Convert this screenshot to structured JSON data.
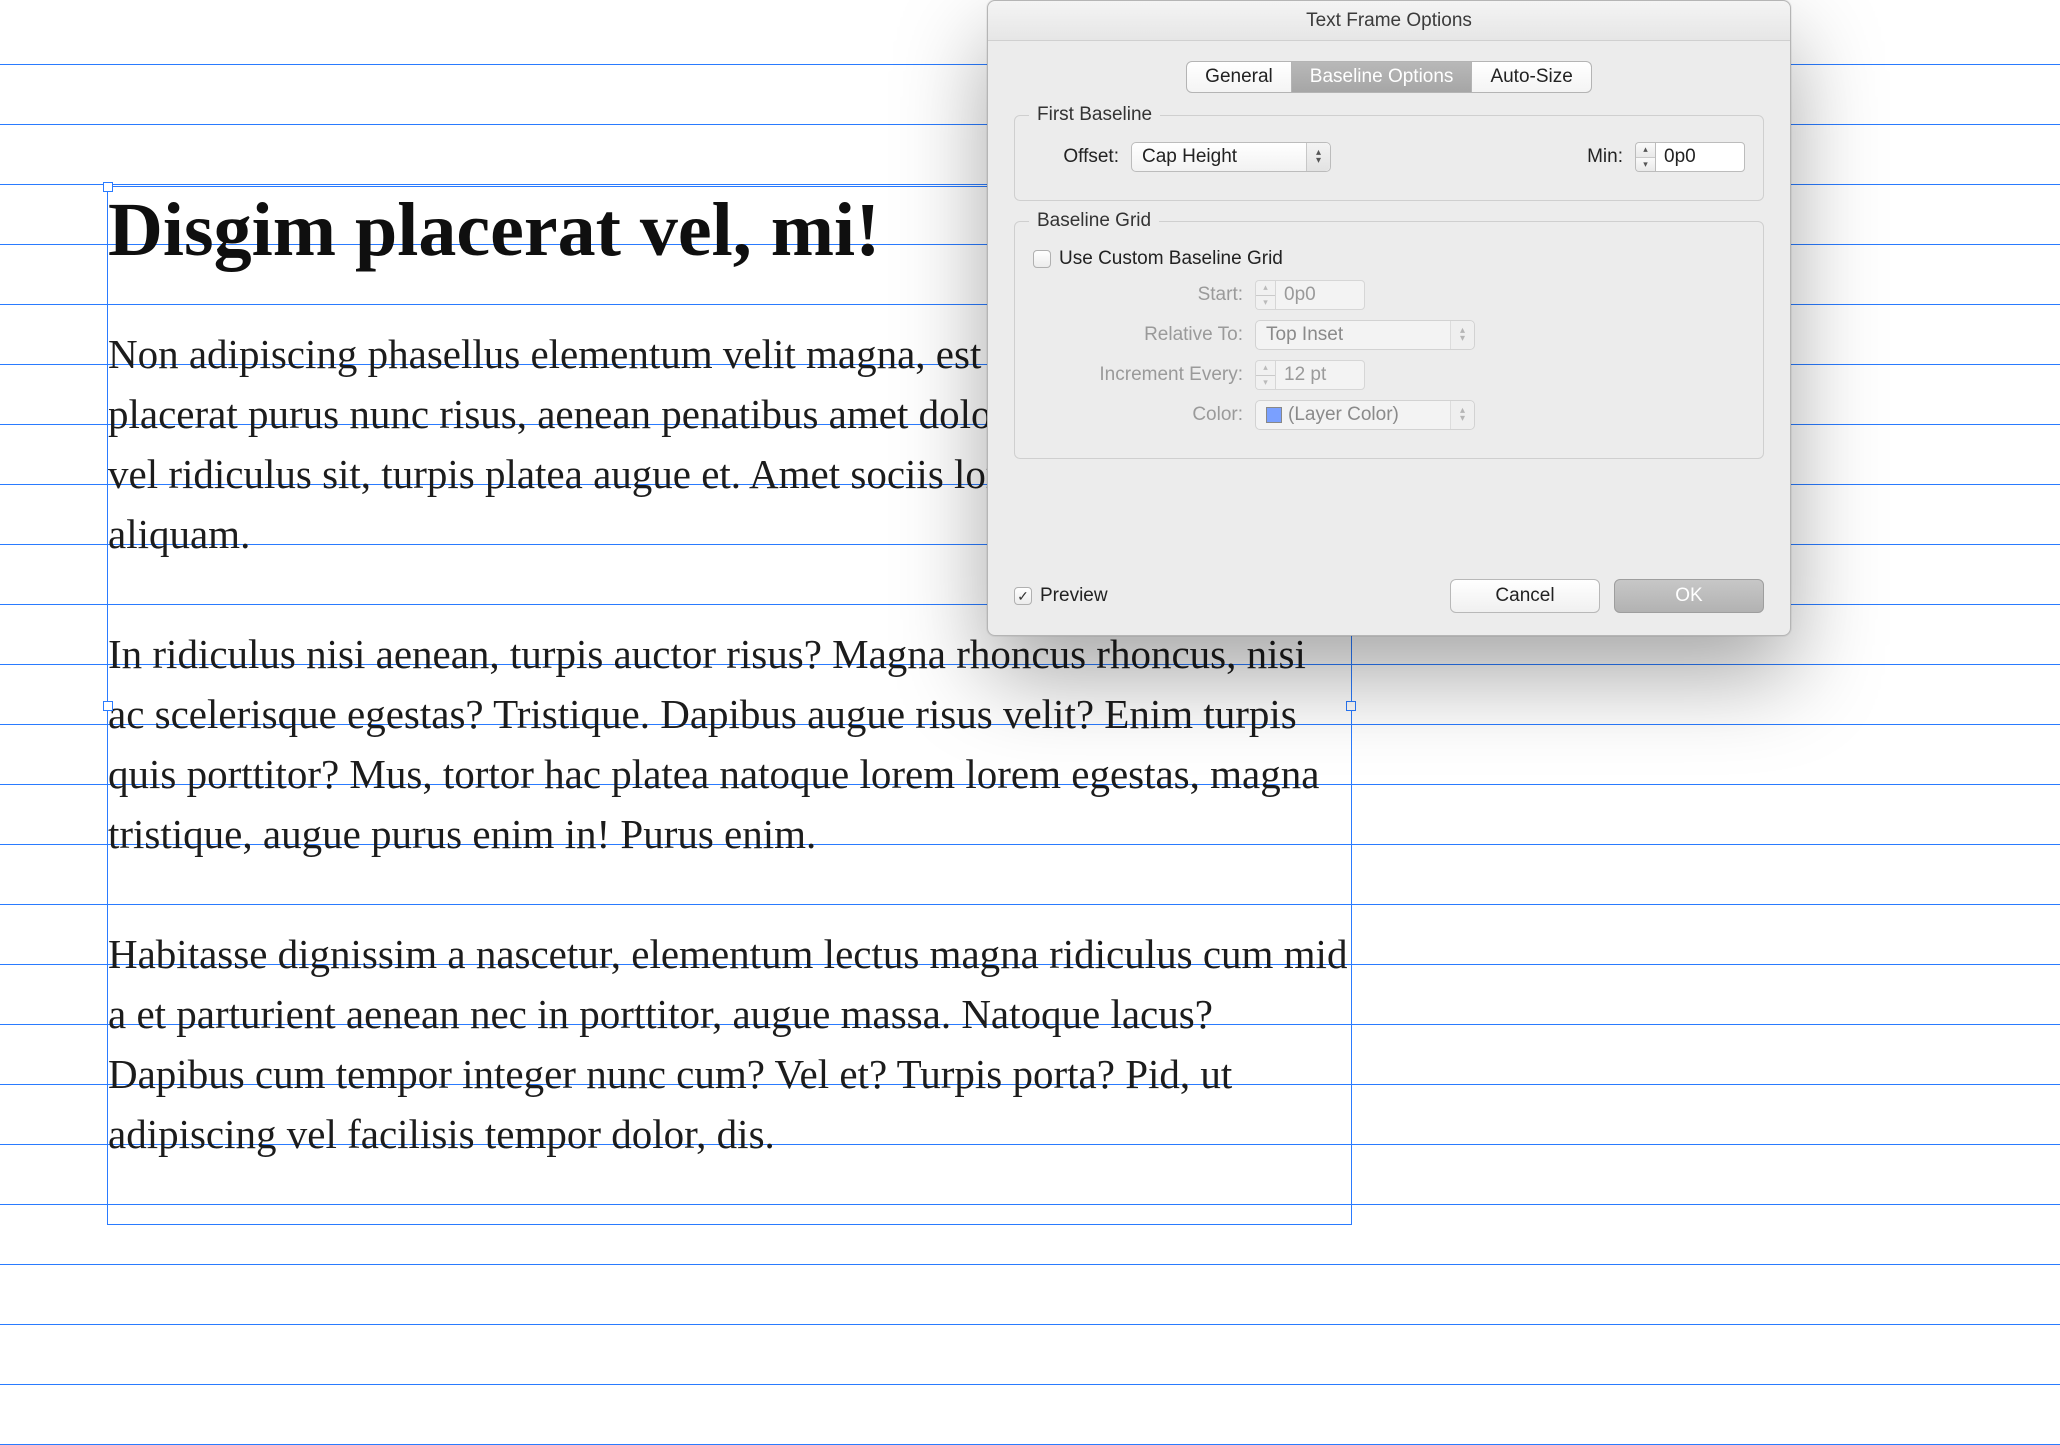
{
  "dialog": {
    "title": "Text Frame Options",
    "tabs": {
      "general": "General",
      "baseline": "Baseline Options",
      "auto": "Auto-Size"
    },
    "group1": {
      "legend": "First Baseline",
      "offset_label": "Offset:",
      "offset_value": "Cap Height",
      "min_label": "Min:",
      "min_value": "0p0"
    },
    "group2": {
      "legend": "Baseline Grid",
      "use_custom_label": "Use Custom Baseline Grid",
      "start_label": "Start:",
      "start_value": "0p0",
      "relative_label": "Relative To:",
      "relative_value": "Top Inset",
      "increment_label": "Increment Every:",
      "increment_value": "12 pt",
      "color_label": "Color:",
      "color_value": "(Layer Color)"
    },
    "preview_label": "Preview",
    "cancel": "Cancel",
    "ok": "OK"
  },
  "document": {
    "heading": "Disgim placerat vel, mi!",
    "p1": "Non adipiscing phasellus elementum velit magna, est dis amet arcu magnis placerat purus nunc risus, aenean penatibus amet dolor penatibus tis, nisi vel ridiculus sit, turpis platea augue et. Amet sociis lorem, turpis elit, nisi aliquam.",
    "p2": "In ridiculus nisi aenean, turpis auctor risus? Magna rhoncus rhoncus, nisi ac scelerisque egestas? Tristique. Dapibus augue risus velit? Enim turpis quis porttitor? Mus, tortor hac platea natoque lorem lorem egestas, magna tristique, augue purus enim in! Purus enim.",
    "p3": "Habitasse dignissim a nascetur, elementum lectus magna ridiculus cum mid a et parturient aenean nec in porttitor, augue massa. Natoque lacus? Dapibus cum tempor integer nunc cum? Vel et? Turpis porta? Pid, ut adipiscing vel facilisis tempor dolor, dis."
  }
}
